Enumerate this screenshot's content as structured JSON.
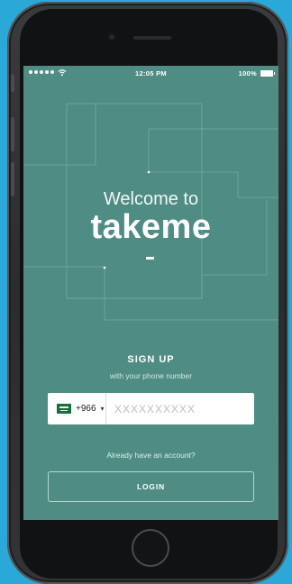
{
  "status_bar": {
    "time": "12:05 PM",
    "battery_percent": "100%",
    "signal_icon": "signal-dots-icon",
    "wifi_icon": "wifi-icon",
    "battery_icon": "battery-icon"
  },
  "hero": {
    "welcome": "Welcome to",
    "brand": "takeme"
  },
  "signup": {
    "title": "SIGN UP",
    "subtitle": "with your phone number"
  },
  "phone_input": {
    "country_flag": "saudi-arabia-flag-icon",
    "country_code": "+966",
    "chevron": "▾",
    "placeholder": "XXXXXXXXXX",
    "value": ""
  },
  "login": {
    "prompt": "Already have an account?",
    "button_label": "LOGIN"
  },
  "colors": {
    "screen_bg": "#4e8c84",
    "page_bg": "#2aa8d8",
    "accent": "#ffffff"
  }
}
